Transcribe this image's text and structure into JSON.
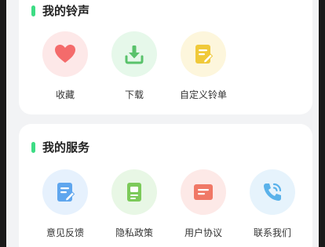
{
  "colors": {
    "accent": "#3ddc84",
    "heart_bg": "#fde8e8",
    "heart": "#f46b6b",
    "download_bg": "#e6f8ea",
    "download": "#59c26b",
    "custom_bg": "#fdf6dc",
    "custom": "#f0c93a",
    "feedback_bg": "#e6f1fd",
    "feedback": "#5fa6ee",
    "privacy_bg": "#e8f7e5",
    "privacy": "#7cca5a",
    "agreement_bg": "#fde9e7",
    "agreement": "#f07866",
    "contact_bg": "#e6f3fc",
    "contact": "#5ab2ea"
  },
  "my_ringtones": {
    "title": "我的铃声",
    "items": [
      {
        "label": "收藏",
        "icon": "heart-icon"
      },
      {
        "label": "下载",
        "icon": "download-icon"
      },
      {
        "label": "自定义铃单",
        "icon": "edit-note-icon"
      }
    ]
  },
  "my_services": {
    "title": "我的服务",
    "items": [
      {
        "label": "意见反馈",
        "icon": "feedback-icon"
      },
      {
        "label": "隐私政策",
        "icon": "privacy-document-icon"
      },
      {
        "label": "用户协议",
        "icon": "agreement-icon"
      },
      {
        "label": "联系我们",
        "icon": "phone-icon"
      }
    ]
  }
}
